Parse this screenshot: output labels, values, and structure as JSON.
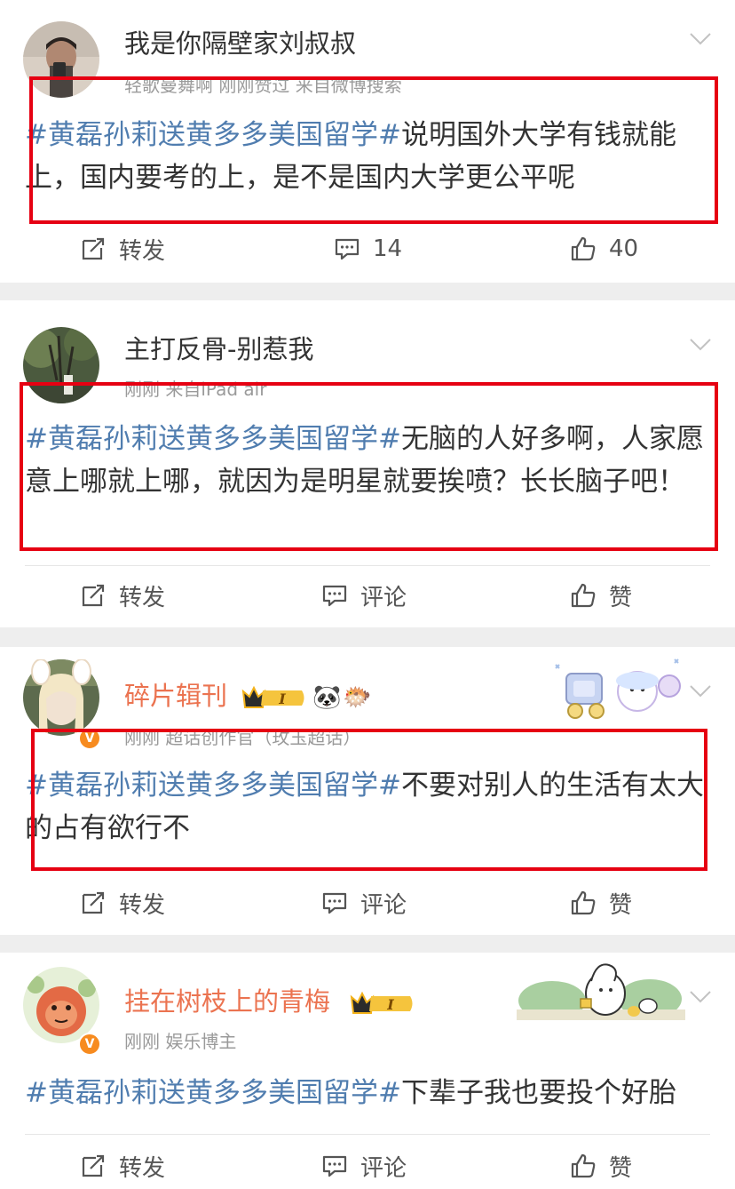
{
  "colors": {
    "topic": "#507daf",
    "vip_name": "#eb7350",
    "highlight_box": "#e60012",
    "verified_badge": "#f78b1f"
  },
  "posts": [
    {
      "username": "我是你隔壁家刘叔叔",
      "meta": "轻歌曼舞啊 刚刚赞过 来自微博搜索",
      "topic": "#黄磊孙莉送黄多多美国留学#",
      "text": "说明国外大学有钱就能上，国内要考的上，是不是国内大学更公平呢",
      "actions": {
        "repost": "转发",
        "comment": "14",
        "like": "40"
      }
    },
    {
      "username": "主打反骨-别惹我",
      "meta": "刚刚 来自iPad air",
      "topic": "#黄磊孙莉送黄多多美国留学#",
      "text": "无脑的人好多啊，人家愿意上哪就上哪，就因为是明星就要挨喷？长长脑子吧！",
      "actions": {
        "repost": "转发",
        "comment": "评论",
        "like": "赞"
      }
    },
    {
      "username": "碎片辑刊",
      "meta": "刚刚 超话创作官（玫玉超话）",
      "topic": "#黄磊孙莉送黄多多美国留学#",
      "text": "不要对别人的生活有太大的占有欲行不",
      "vip_level": "I",
      "emojis": [
        "🐼",
        "🐡"
      ],
      "actions": {
        "repost": "转发",
        "comment": "评论",
        "like": "赞"
      }
    },
    {
      "username": "挂在树枝上的青梅",
      "meta": "刚刚 娱乐博主",
      "topic": "#黄磊孙莉送黄多多美国留学#",
      "text": "下辈子我也要投个好胎",
      "vip_level": "I",
      "actions": {
        "repost": "转发",
        "comment": "评论",
        "like": "赞"
      }
    }
  ],
  "icons": {
    "repost": "repost-icon",
    "comment": "comment-icon",
    "like": "like-icon",
    "more": "chevron-down-icon",
    "verified": "verified-badge-icon",
    "vip": "vip-crown-icon"
  },
  "verified_mark": "V"
}
